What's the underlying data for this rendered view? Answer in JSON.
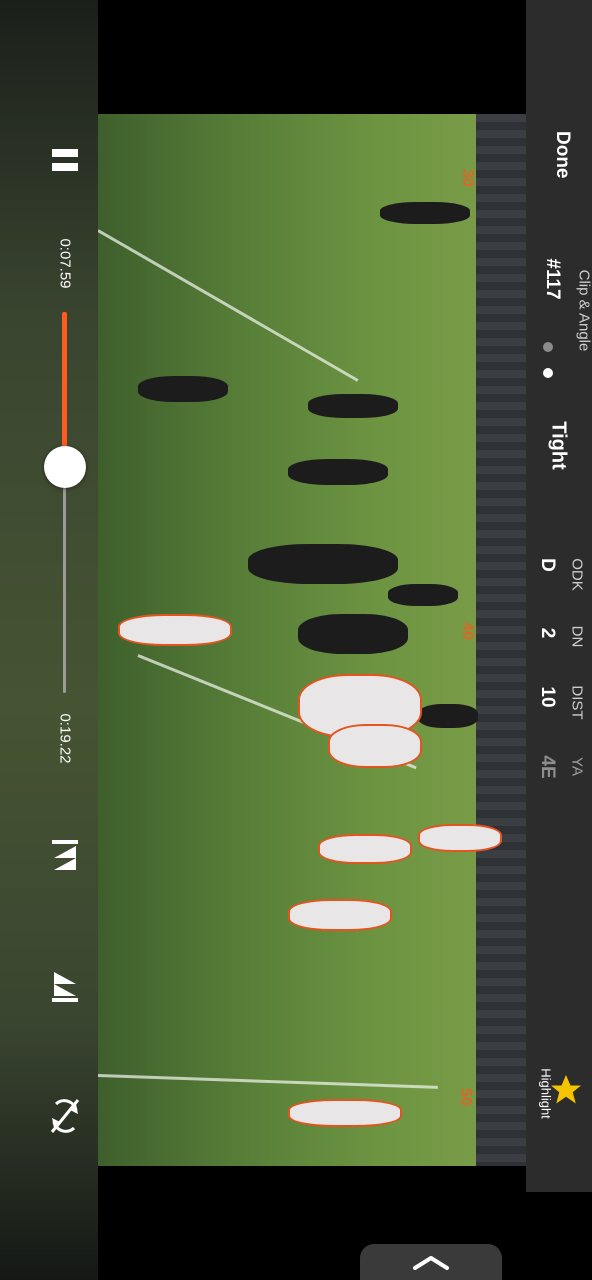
{
  "controls": {
    "pause_icon": "pause-icon",
    "elapsed": "0:07.59",
    "total": "0:19.22",
    "progress_fraction": 0.395,
    "prev_icon": "skip-back-icon",
    "next_icon": "skip-forward-icon",
    "autoplay_icon": "autoplay-disabled-icon"
  },
  "info": {
    "done_label": "Done",
    "clip_angle_label": "Clip & Angle",
    "clip_number": "#117",
    "angle_name": "Tight",
    "angle_pages": 2,
    "angle_active_index": 1,
    "stats": [
      {
        "header": "ODK",
        "value": "D"
      },
      {
        "header": "DN",
        "value": "2"
      },
      {
        "header": "DIST",
        "value": "10"
      },
      {
        "header": "YA",
        "value": "4E"
      }
    ],
    "highlight_label": "Highlight",
    "highlight_icon": "star-icon",
    "highlight_color": "#f6c300"
  },
  "field": {
    "yard_numbers": [
      "30",
      "40",
      "50"
    ]
  },
  "home": {
    "chevron_icon": "chevron-up-icon"
  },
  "colors": {
    "accent": "#ff5a1f",
    "panel_bg": "#2c2c2c"
  }
}
